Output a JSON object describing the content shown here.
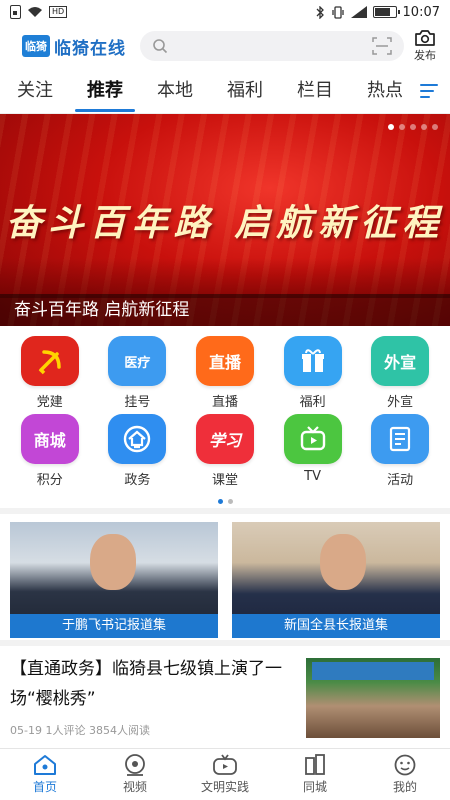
{
  "status_bar": {
    "time": "10:07",
    "hd": "HD"
  },
  "header": {
    "logo_mark": "临猗",
    "app_name": "临猗在线",
    "search_placeholder": "",
    "publish_label": "发布"
  },
  "tabs": [
    {
      "label": "关注"
    },
    {
      "label": "推荐"
    },
    {
      "label": "本地"
    },
    {
      "label": "福利"
    },
    {
      "label": "栏目"
    },
    {
      "label": "热点"
    }
  ],
  "banner": {
    "headline": "奋斗百年路  启航新征程",
    "caption": "奋斗百年路 启航新征程",
    "slide_count": 5,
    "active_slide": 1
  },
  "services": [
    {
      "label": "党建",
      "icon": "party-emblem-icon",
      "color": "#e0261d"
    },
    {
      "label": "挂号",
      "icon": "medical-icon",
      "color": "#3d9bf0",
      "glyph": "医疗"
    },
    {
      "label": "直播",
      "icon": "live-icon",
      "color": "#ff6a1a",
      "glyph": "直播"
    },
    {
      "label": "福利",
      "icon": "gift-icon",
      "color": "#36a4f2"
    },
    {
      "label": "外宣",
      "icon": "publicity-icon",
      "color": "#2fc3a6",
      "glyph": "外宣"
    },
    {
      "label": "积分",
      "icon": "mall-icon",
      "color": "#c247d6",
      "glyph": "商城"
    },
    {
      "label": "政务",
      "icon": "government-icon",
      "color": "#2f8ef0"
    },
    {
      "label": "课堂",
      "icon": "study-icon",
      "color": "#ef2f3a",
      "glyph": "学习"
    },
    {
      "label": "TV",
      "icon": "tv-icon",
      "color": "#4cc640"
    },
    {
      "label": "活动",
      "icon": "activity-icon",
      "color": "#3d9bf0"
    }
  ],
  "service_pages": {
    "count": 2,
    "active": 1
  },
  "feature_cards": [
    {
      "caption": "于鹏飞书记报道集"
    },
    {
      "caption": "新国全县长报道集"
    }
  ],
  "news": [
    {
      "title": "【直通政务】临猗县七级镇上演了一场“樱桃秀”",
      "date": "05-19",
      "comments": "1人评论",
      "reads": "3854人阅读"
    }
  ],
  "bottom_nav": [
    {
      "label": "首页",
      "icon": "home-icon",
      "active": true
    },
    {
      "label": "视频",
      "icon": "video-icon",
      "active": false
    },
    {
      "label": "文明实践",
      "icon": "practice-icon",
      "active": false
    },
    {
      "label": "同城",
      "icon": "city-icon",
      "active": false
    },
    {
      "label": "我的",
      "icon": "profile-icon",
      "active": false
    }
  ],
  "colors": {
    "accent": "#1e7ad7",
    "banner_red": "#c8100c"
  }
}
